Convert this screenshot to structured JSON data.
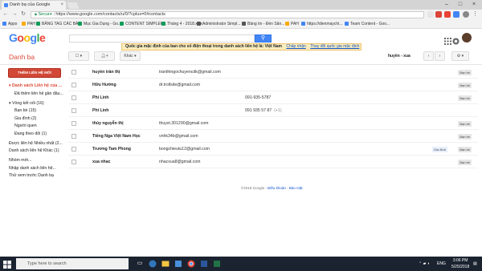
{
  "browser": {
    "tab_title": "Danh bạ của Google",
    "url_secure": "Secure",
    "url": "https://www.google.com/contacts/u/0/?cplus=0#contacts",
    "bookmarks": [
      {
        "label": "Apps",
        "color": "#4285f4"
      },
      {
        "label": "PAH",
        "color": "#f9ab00"
      },
      {
        "label": "BẢNG TAG CÁC BÀI",
        "color": "#0f9d58"
      },
      {
        "label": "Mục Gia Dụng - Go...",
        "color": "#0f9d58"
      },
      {
        "label": "CONTENT SIMPLEH...",
        "color": "#0f9d58"
      },
      {
        "label": "Tháng 4 - 2018.xlsx",
        "color": "#0f9d58"
      },
      {
        "label": "Administrator Simpl...",
        "color": "#555555"
      },
      {
        "label": "Bảng tin - Đèn Sân...",
        "color": "#555555"
      },
      {
        "label": "PAH",
        "color": "#f9ab00"
      },
      {
        "label": "https://dienmaychi...",
        "color": "#4285f4"
      },
      {
        "label": "Team Content - Goo...",
        "color": "#4285f4"
      }
    ]
  },
  "header": {
    "logo_letters": [
      {
        "ch": "G",
        "color": "#4285f4"
      },
      {
        "ch": "o",
        "color": "#ea4335"
      },
      {
        "ch": "o",
        "color": "#fbbc05"
      },
      {
        "ch": "g",
        "color": "#4285f4"
      },
      {
        "ch": "l",
        "color": "#34a853"
      },
      {
        "ch": "e",
        "color": "#ea4335"
      }
    ],
    "search_placeholder": ""
  },
  "notice": {
    "text": "Quốc gia mặc định của ban cho số điện thoại trong danh sách liên hệ là: Việt Nam",
    "accept": "Chấp nhận",
    "change": "Thay đổi quốc gia mặc định"
  },
  "app": {
    "title": "Danh bạ",
    "more_button": "Khác",
    "pager": "huyền - xua"
  },
  "sidebar": {
    "new_contact": "THÊM LIÊN HỆ MỚI",
    "items": [
      {
        "label": "▾ Danh sách Liên hệ của ...",
        "selected": true,
        "indent": 0
      },
      {
        "label": "Đã thêm liên hệ gần đâu...",
        "selected": false,
        "indent": 1
      },
      {
        "label": "▾ Vòng kết nối (16)",
        "selected": false,
        "indent": 0
      },
      {
        "label": "Bạn bè (15)",
        "selected": false,
        "indent": 1
      },
      {
        "label": "Gia đình (2)",
        "selected": false,
        "indent": 1
      },
      {
        "label": "Người quen",
        "selected": false,
        "indent": 1
      },
      {
        "label": "Đang theo dõi (1)",
        "selected": false,
        "indent": 1
      },
      {
        "label": "Được liên hệ Nhiều nhất (2...",
        "selected": false,
        "indent": 0
      },
      {
        "label": "Danh sách liên hệ Khác (1)",
        "selected": false,
        "indent": 0
      },
      {
        "label": "Nhóm mới...",
        "selected": false,
        "indent": 0
      },
      {
        "label": "Nhập danh sách liên hệ...",
        "selected": false,
        "indent": 0
      },
      {
        "label": "Thử xem trước Danh bạ",
        "selected": false,
        "indent": 0
      }
    ]
  },
  "contacts": [
    {
      "name": "huyền trần thị",
      "email": "tranthingochuyencdk@gmail.com",
      "phone": "",
      "phone2": "",
      "tags": [
        "Bạn bè"
      ]
    },
    {
      "name": "Hữu Hường",
      "email": "dr.trollsite@gmail.com",
      "phone": "",
      "phone2": "",
      "tags": [
        "Bạn bè"
      ]
    },
    {
      "name": "Phi Linh",
      "email": "",
      "phone": "091-935-5787",
      "phone2": "",
      "tags": [
        "Bạn bè"
      ]
    },
    {
      "name": "Phi Linh",
      "email": "",
      "phone": "091 935 57 87",
      "phone2": "(+1)",
      "tags": []
    },
    {
      "name": "thủy nguyễn thị",
      "email": "thuyxt.301290@gmail.com",
      "phone": "",
      "phone2": "",
      "tags": [
        "Bạn bè"
      ]
    },
    {
      "name": "Tiếng Nga Việt Nam Học",
      "email": "vnhk34b@gmail.com",
      "phone": "",
      "phone2": "",
      "tags": [
        "Bạn bè"
      ]
    },
    {
      "name": "Trương Tam Phong",
      "email": "bongchieutu12@gmail.com",
      "phone": "",
      "phone2": "",
      "tags": [
        "Gia đình",
        "Bạn bè"
      ]
    },
    {
      "name": "xua nhac",
      "email": "nhacxua8@gmail.com",
      "phone": "",
      "phone2": "",
      "tags": [
        "Bạn bè"
      ]
    }
  ],
  "footer": {
    "copyright": "©2018 Google -",
    "terms": "Điều khoản",
    "sep": "-",
    "privacy": "Bảo mật"
  },
  "taskbar": {
    "search_placeholder": "Type here to search",
    "lang": "ENG",
    "time": "3:06 PM",
    "date": "5/25/2018"
  }
}
